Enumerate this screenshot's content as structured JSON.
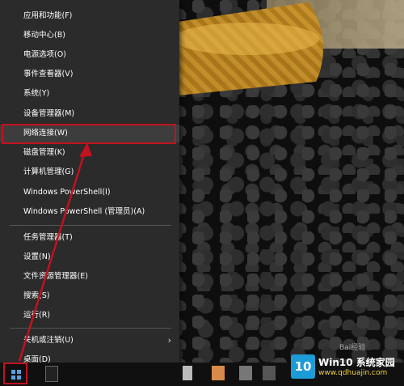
{
  "menu": {
    "items": [
      {
        "label": "应用和功能(F)"
      },
      {
        "label": "移动中心(B)"
      },
      {
        "label": "电源选项(O)"
      },
      {
        "label": "事件查看器(V)"
      },
      {
        "label": "系统(Y)"
      },
      {
        "label": "设备管理器(M)"
      },
      {
        "label": "网络连接(W)"
      },
      {
        "label": "磁盘管理(K)"
      },
      {
        "label": "计算机管理(G)"
      },
      {
        "label": "Windows PowerShell(I)"
      },
      {
        "label": "Windows PowerShell (管理员)(A)"
      },
      {
        "label": "任务管理器(T)"
      },
      {
        "label": "设置(N)"
      },
      {
        "label": "文件资源管理器(E)"
      },
      {
        "label": "搜索(S)"
      },
      {
        "label": "运行(R)"
      },
      {
        "label": "关机或注销(U)"
      },
      {
        "label": "桌面(D)"
      }
    ],
    "highlighted_item": "网络连接(W)"
  },
  "watermark": {
    "logo_text": "10",
    "title": "Win10 系统家园",
    "url": "www.qdhuajin.com"
  },
  "colors": {
    "menu_bg": "#2b2b2b",
    "highlight": "#c1121f",
    "arrow": "#c1121f",
    "brand_blue": "#1c9bd6"
  },
  "icons": [
    "windows-start-icon",
    "chevron-right-icon",
    "calculator-icon",
    "arrow-annotation"
  ]
}
